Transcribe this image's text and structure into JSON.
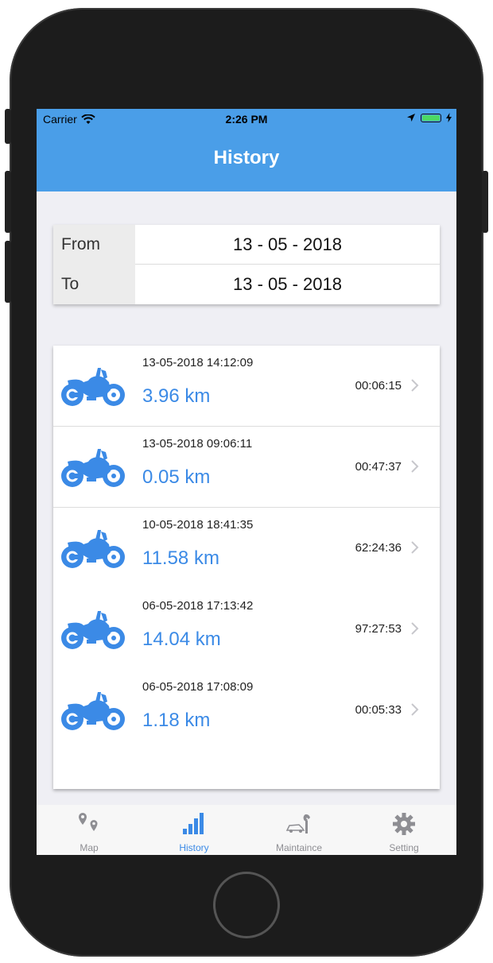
{
  "status_bar": {
    "carrier": "Carrier",
    "time": "2:26 PM"
  },
  "nav": {
    "title": "History"
  },
  "date_filter": {
    "from_label": "From",
    "from_value": "13 - 05 - 2018",
    "to_label": "To",
    "to_value": "13 - 05 - 2018"
  },
  "trips": [
    {
      "datetime": "13-05-2018 14:12:09",
      "distance": "3.96 km",
      "duration": "00:06:15"
    },
    {
      "datetime": "13-05-2018 09:06:11",
      "distance": "0.05 km",
      "duration": "00:47:37"
    },
    {
      "datetime": "10-05-2018 18:41:35",
      "distance": "11.58 km",
      "duration": "62:24:36"
    },
    {
      "datetime": "06-05-2018 17:13:42",
      "distance": "14.04 km",
      "duration": "97:27:53"
    },
    {
      "datetime": "06-05-2018 17:08:09",
      "distance": "1.18 km",
      "duration": "00:05:33"
    }
  ],
  "tabs": [
    {
      "label": "Map",
      "icon": "map-pins-icon"
    },
    {
      "label": "History",
      "icon": "bar-chart-icon"
    },
    {
      "label": "Maintaince",
      "icon": "car-wrench-icon"
    },
    {
      "label": "Setting",
      "icon": "gear-icon"
    }
  ],
  "colors": {
    "accent": "#4a9ee8",
    "distance": "#3b8ae6",
    "tab_inactive": "#8e8e93"
  }
}
